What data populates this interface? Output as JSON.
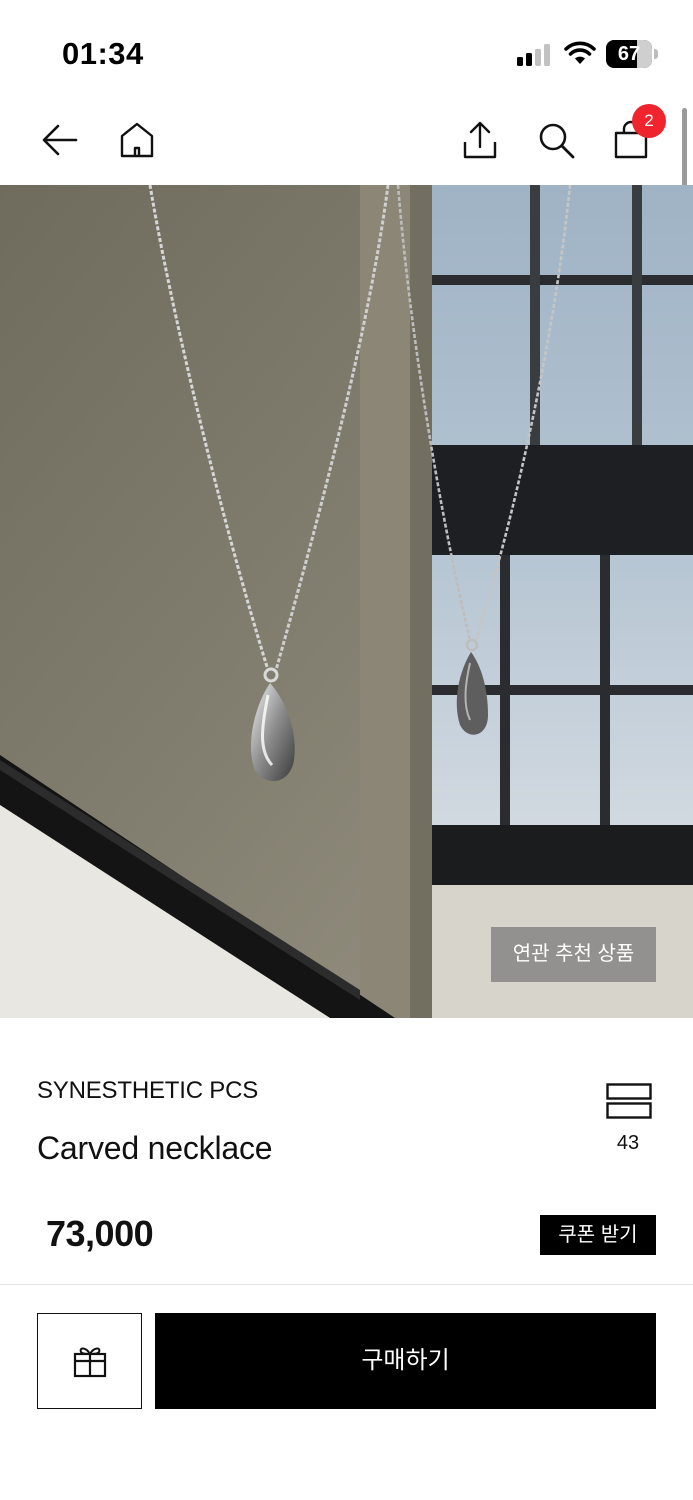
{
  "status_bar": {
    "time": "01:34",
    "battery_percent": "67",
    "battery_level": 0.67,
    "icons": [
      "signal-icon",
      "wifi-icon",
      "battery-icon"
    ]
  },
  "nav": {
    "icons": [
      "back-arrow-icon",
      "home-icon",
      "share-icon",
      "search-icon",
      "shopping-bag-icon"
    ],
    "cart_count": "2",
    "badge_color": "#f0242d"
  },
  "product": {
    "image_icon": "necklace-photo",
    "related_label": "연관 추천 상품",
    "brand": "SYNESTHETIC PCS",
    "name": "Carved necklace",
    "likes_icon": "stack-icon",
    "likes_count": "43",
    "price": "73,000",
    "coupon_label": "쿠폰 받기"
  },
  "actions": {
    "gift_icon": "gift-icon",
    "buy_label": "구매하기"
  },
  "colors": {
    "primary": "#000000",
    "badge": "#f0242d",
    "background": "#ffffff"
  }
}
